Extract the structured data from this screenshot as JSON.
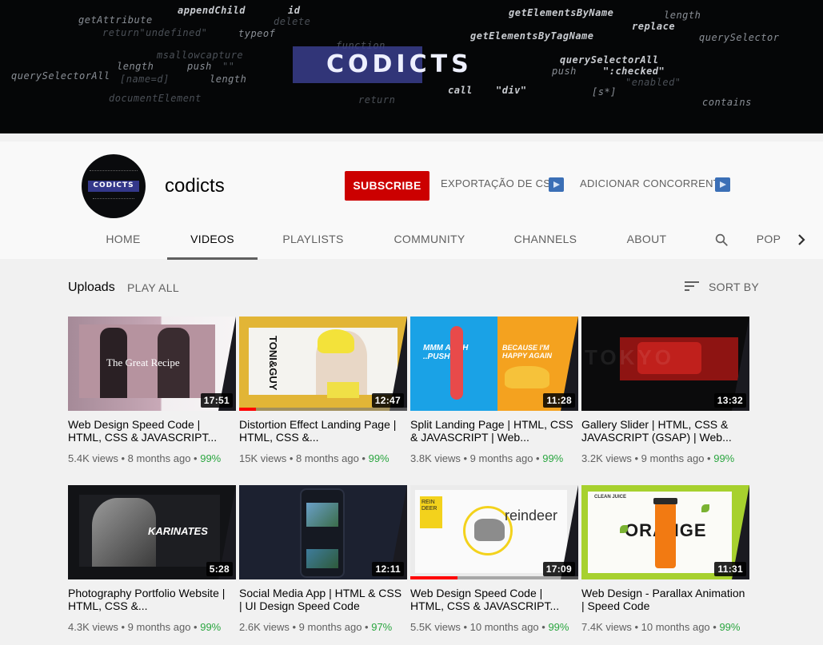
{
  "banner": {
    "logo_text": "CODICTS",
    "code_lines": [
      "appendChild",
      "id",
      "getAttribute",
      "delete",
      "getElementsByName",
      "length",
      "replace",
      "return\"undefined\"",
      "typeof",
      "getElementsByTagName",
      "querySelector",
      "msallowcapture",
      "function",
      "length",
      "push",
      "\"\"",
      "querySelectorAll",
      "querySelectorAll",
      "[name=d]",
      "length",
      "push",
      "\":checked\"",
      "\"enabled\"",
      "documentElement",
      "return",
      "call",
      "\"div\"",
      "[s*]",
      "contains"
    ]
  },
  "avatar": {
    "text": "CODICTS"
  },
  "channel": {
    "name": "codicts",
    "subscribe_label": "SUBSCRIBE",
    "export_csv_label": "EXPORTAÇÃO DE CSV",
    "add_competitor_label": "ADICIONAR CONCORRENTE"
  },
  "tabs": [
    {
      "label": "HOME"
    },
    {
      "label": "VIDEOS"
    },
    {
      "label": "PLAYLISTS"
    },
    {
      "label": "COMMUNITY"
    },
    {
      "label": "CHANNELS"
    },
    {
      "label": "ABOUT"
    },
    {
      "label": "POP"
    }
  ],
  "uploads": {
    "title": "Uploads",
    "play_all_label": "PLAY ALL",
    "sort_label": "SORT BY"
  },
  "videos": [
    {
      "title": "Web Design Speed Code | HTML, CSS & JAVASCRIPT...",
      "views": "5.4K views",
      "age": "8 months ago",
      "rating": "99%",
      "duration": "17:51",
      "thumb_text": "The Great Recipe"
    },
    {
      "title": "Distortion Effect Landing Page | HTML, CSS &...",
      "views": "15K views",
      "age": "8 months ago",
      "rating": "99%",
      "duration": "12:47",
      "watched": 0.1,
      "thumb_text": "TONI&GUY"
    },
    {
      "title": "Split Landing Page | HTML, CSS & JAVASCRIPT | Web...",
      "views": "3.8K views",
      "age": "9 months ago",
      "rating": "99%",
      "duration": "11:28",
      "thumb_text": "MMM AHHH ..PUSH IT!",
      "thumb_text2": "BECAUSE I'M HAPPY AGAIN"
    },
    {
      "title": "Gallery Slider | HTML, CSS & JAVASCRIPT (GSAP) | Web...",
      "views": "3.2K views",
      "age": "9 months ago",
      "rating": "99%",
      "duration": "13:32",
      "thumb_text": "TOKYO"
    },
    {
      "title": "Photography Portfolio Website | HTML, CSS &...",
      "views": "4.3K views",
      "age": "9 months ago",
      "rating": "99%",
      "duration": "5:28",
      "thumb_text": "KARINATES"
    },
    {
      "title": "Social Media App | HTML & CSS | UI Design Speed Code",
      "views": "2.6K views",
      "age": "9 months ago",
      "rating": "97%",
      "duration": "12:11"
    },
    {
      "title": "Web Design Speed Code | HTML, CSS & JAVASCRIPT...",
      "views": "5.5K views",
      "age": "10 months ago",
      "rating": "99%",
      "duration": "17:09",
      "watched": 0.28,
      "thumb_text": "reindeer",
      "thumb_text2": "REIN DEER"
    },
    {
      "title": "Web Design - Parallax Animation | Speed Code",
      "views": "7.4K views",
      "age": "10 months ago",
      "rating": "99%",
      "duration": "11:31",
      "thumb_text": "ORANGE",
      "thumb_text2": "CLEAN JUICE"
    }
  ]
}
